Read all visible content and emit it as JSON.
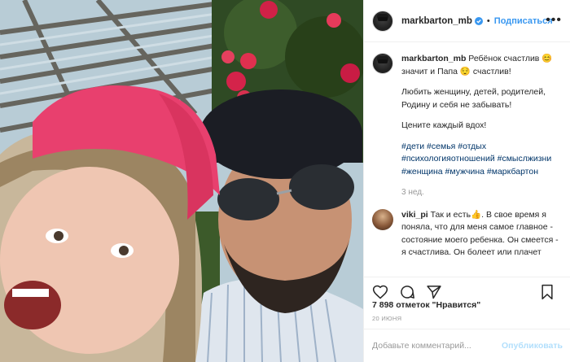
{
  "post": {
    "photo_alt": "",
    "header": {
      "username": "markbarton_mb",
      "follow_label": "Подписаться",
      "more_label": "•••"
    },
    "caption": {
      "username": "markbarton_mb",
      "line1": "Ребёнок счастлив 😊 значит и Папа 😌 счастлив!",
      "para2": "Любить женщину, детей, родителей, Родину и себя не забывать!",
      "para3": "Цените каждый вдох!",
      "hashtags": "#дети #семья #отдых #психологияотношений #смыслжизни #женщина #мужчина #маркбартон",
      "time": "3 нед."
    },
    "comment": {
      "username": "viki_pi",
      "text": "Так и есть👍. В свое время я поняла, что для меня самое главное - состояние моего ребенка. Он смеется - я счастлива. Он болеет или плачет"
    },
    "likes": "7 898 отметок \"Нравится\"",
    "date": "20 июня",
    "add_comment": {
      "placeholder": "Добавьте комментарий...",
      "publish_label": "Опубликовать"
    },
    "icons": {
      "like": "heart-icon",
      "comment": "comment-icon",
      "share": "share-icon",
      "save": "bookmark-icon",
      "verified": "verified-badge-icon"
    },
    "colors": {
      "link_blue": "#3897f0",
      "hashtag": "#003569",
      "muted": "#999999",
      "publish_disabled": "#b2dffc"
    }
  }
}
